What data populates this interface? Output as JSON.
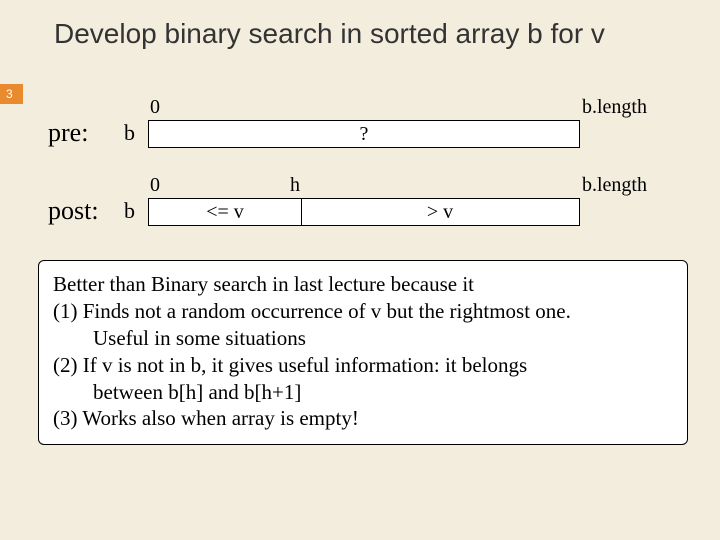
{
  "page_number": "3",
  "title": "Develop binary search in sorted array b for v",
  "pre": {
    "label": "pre:",
    "array_name": "b",
    "left_index": "0",
    "right_index": "b.length",
    "content": "?"
  },
  "post": {
    "label": "post:",
    "array_name": "b",
    "left_index": "0",
    "mid_index": "h",
    "right_index": "b.length",
    "left_region": "<= v",
    "right_region": "> v"
  },
  "notes": {
    "intro": "Better than Binary search in last lecture because it",
    "p1a": "(1) Finds not a random occurrence of v but the rightmost one.",
    "p1b": "Useful in some situations",
    "p2a": "(2) If v is not in b, it gives useful information: it belongs",
    "p2b": "between b[h] and b[h+1]",
    "p3": "(3) Works also when array is empty!"
  }
}
